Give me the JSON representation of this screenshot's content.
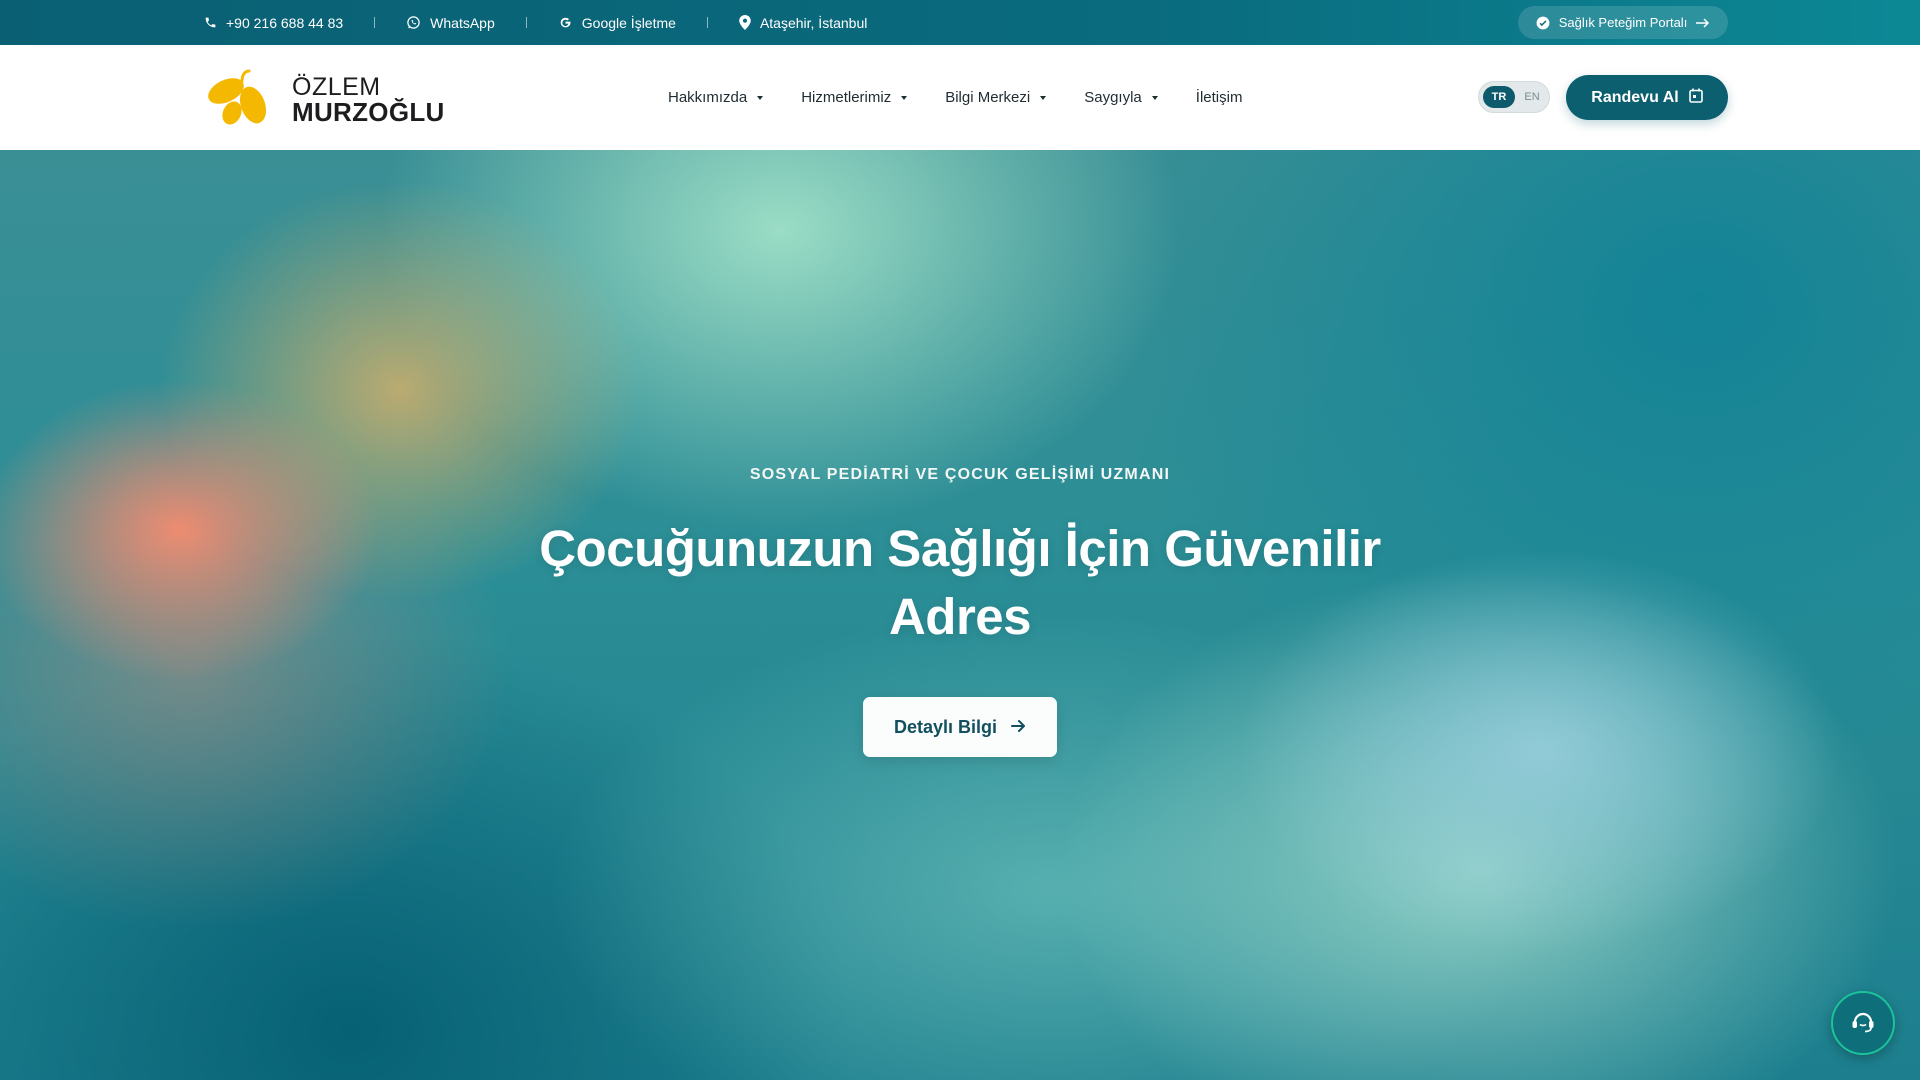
{
  "topbar": {
    "phone": "+90 216 688 44 83",
    "whatsapp": "WhatsApp",
    "google": "Google İşletme",
    "location": "Ataşehir, İstanbul",
    "portal": "Sağlık Peteğim Portalı"
  },
  "header": {
    "logo_line1": "ÖZLEM",
    "logo_line2": "MURZOĞLU",
    "nav": [
      "Hakkımızda",
      "Hizmetlerimiz",
      "Bilgi Merkezi",
      "Saygıyla",
      "İletişim"
    ],
    "lang_tr": "TR",
    "lang_en": "EN",
    "appointment": "Randevu Al"
  },
  "hero": {
    "subtitle": "SOSYAL PEDİATRİ VE ÇOCUK GELİŞİMİ UZMANI",
    "title": "Çocuğunuzun Sağlığı İçin Güvenilir Adres",
    "cta": "Detaylı Bilgi"
  },
  "colors": {
    "topbar": "#0a6b7e",
    "primary": "#0c5f6f",
    "logo_yellow": "#f5b800"
  },
  "icons": [
    "phone-icon",
    "whatsapp-icon",
    "google-icon",
    "location-pin-icon",
    "check-circle-icon",
    "arrow-right-icon",
    "calendar-icon",
    "support-chat-icon"
  ]
}
